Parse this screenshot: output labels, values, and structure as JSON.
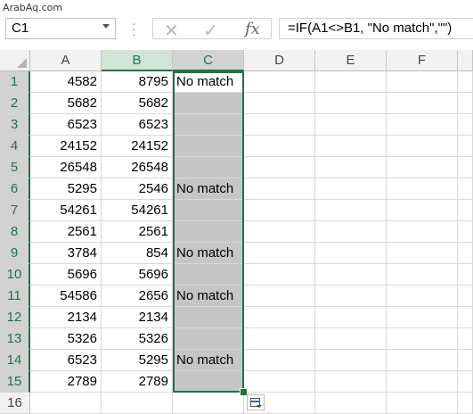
{
  "watermark": "ArabAq.com",
  "name_box": {
    "value": "C1"
  },
  "formula_bar": {
    "cancel_icon": "x-icon",
    "enter_icon": "check-icon",
    "fx_label": "fx",
    "formula": "=IF(A1<>B1, \"No match\",\"\")"
  },
  "columns": [
    "A",
    "B",
    "C",
    "D",
    "E",
    "F"
  ],
  "rows": [
    {
      "n": "1",
      "a": "4582",
      "b": "8795",
      "c": "No match"
    },
    {
      "n": "2",
      "a": "5682",
      "b": "5682",
      "c": ""
    },
    {
      "n": "3",
      "a": "6523",
      "b": "6523",
      "c": ""
    },
    {
      "n": "4",
      "a": "24152",
      "b": "24152",
      "c": ""
    },
    {
      "n": "5",
      "a": "26548",
      "b": "26548",
      "c": ""
    },
    {
      "n": "6",
      "a": "5295",
      "b": "2546",
      "c": "No match"
    },
    {
      "n": "7",
      "a": "54261",
      "b": "54261",
      "c": ""
    },
    {
      "n": "8",
      "a": "2561",
      "b": "2561",
      "c": ""
    },
    {
      "n": "9",
      "a": "3784",
      "b": "854",
      "c": "No match"
    },
    {
      "n": "10",
      "a": "5696",
      "b": "5696",
      "c": ""
    },
    {
      "n": "11",
      "a": "54586",
      "b": "2656",
      "c": "No match"
    },
    {
      "n": "12",
      "a": "2134",
      "b": "2134",
      "c": ""
    },
    {
      "n": "13",
      "a": "5326",
      "b": "5326",
      "c": ""
    },
    {
      "n": "14",
      "a": "6523",
      "b": "5295",
      "c": "No match"
    },
    {
      "n": "15",
      "a": "2789",
      "b": "2789",
      "c": ""
    },
    {
      "n": "16",
      "a": "",
      "b": "",
      "c": ""
    }
  ],
  "colors": {
    "accent": "#217346",
    "selection_fill": "#c6c6c6"
  }
}
